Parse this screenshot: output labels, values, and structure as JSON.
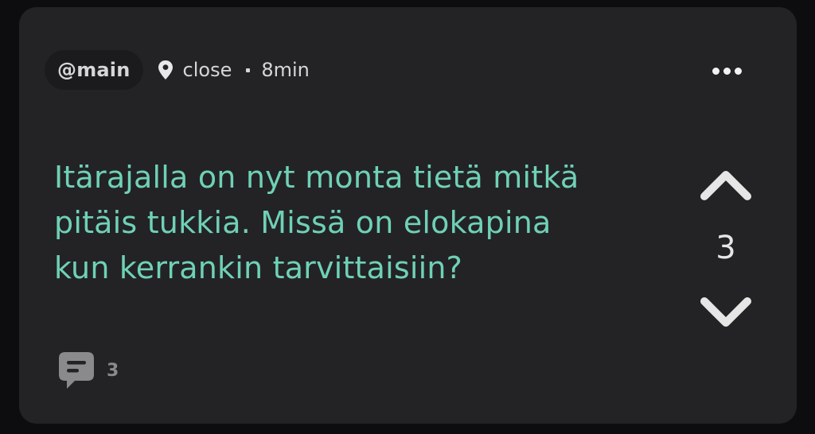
{
  "post": {
    "channel": "@main",
    "location_icon": "map-pin-icon",
    "location": "close",
    "time": "8min",
    "message": "Itärajalla on nyt monta tietä mitkä pitäis tukkia. Missä on elokapina kun kerrankin tarvittaisiin?",
    "message_color": "#6fd1b6",
    "more_icon": "more-horizontal-icon",
    "vote": {
      "upvote_icon": "chevron-up-icon",
      "downvote_icon": "chevron-down-icon",
      "score": "3"
    },
    "comments": {
      "icon": "comment-bubble-icon",
      "count": "3"
    }
  },
  "colors": {
    "background": "#0d0d0f",
    "card": "#232325",
    "accent": "#6fd1b6",
    "text": "#d6d6d6"
  }
}
